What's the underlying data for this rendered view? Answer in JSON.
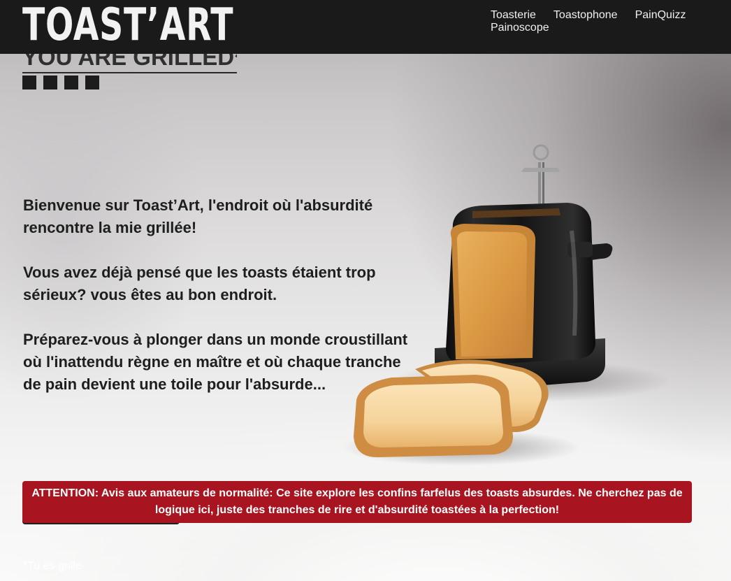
{
  "header": {
    "logo": "TOAST’ART",
    "nav": [
      {
        "label": "Toasterie"
      },
      {
        "label": "Toastophone"
      },
      {
        "label": "PainQuizz"
      },
      {
        "label": "Painoscope"
      }
    ]
  },
  "hero": {
    "heading": "YOU ARE GRILLED*"
  },
  "intro": {
    "paragraphs": [
      "Bienvenue sur Toast’Art, l'endroit où l'absurdité rencontre la mie grillée!",
      "Vous avez déjà pensé que les toasts étaient trop sérieux? vous êtes au bon endroit.",
      "Préparez-vous à plonger dans un monde croustillant où l'inattendu règne en maître et où chaque tranche de pain devient une toile pour l'absurde..."
    ]
  },
  "alert": {
    "text": "ATTENTION: Avis aux amateurs de normalité: Ce site explore les confins farfelus des toasts absurdes. Ne cherchez pas de logique ici, juste des tranches de rire et d'absurdité toastées à la perfection!"
  },
  "footnote": "*Tu es grillé",
  "colors": {
    "header_bg": "#1a1a1a",
    "alert_bg": "#a8141f",
    "text_dark": "#1e1e1e"
  }
}
